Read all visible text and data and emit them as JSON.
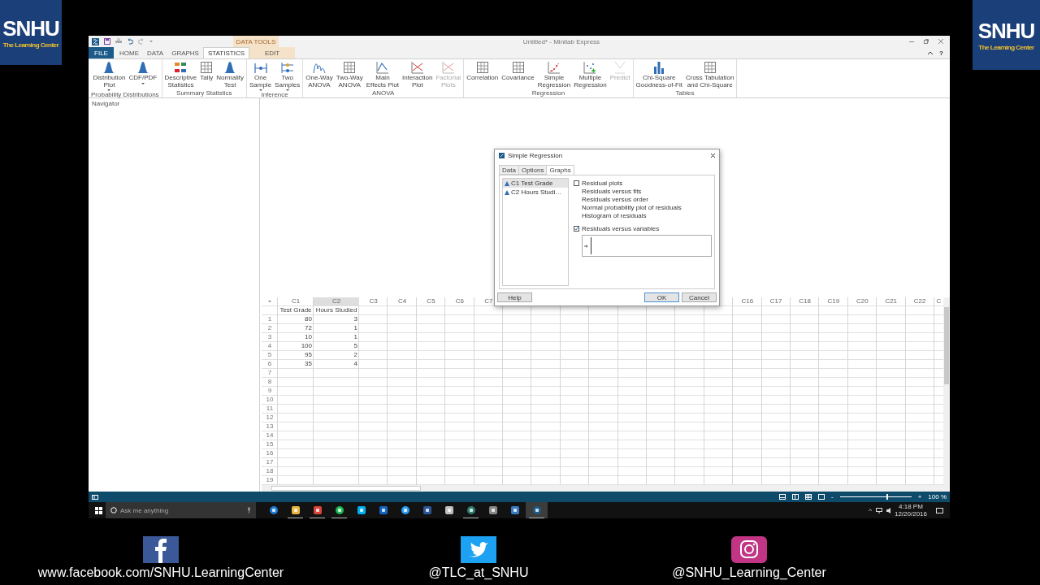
{
  "logos": [
    {
      "title": "SNHU",
      "subtitle": "The Learning Center"
    },
    {
      "title": "SNHU",
      "subtitle": "The Learning Center"
    }
  ],
  "window": {
    "title": "Untitled* - Minitab Express",
    "help_label": "?"
  },
  "contextual_group": "DATA TOOLS",
  "tabs": [
    {
      "label": "FILE",
      "kind": "file",
      "selected": false
    },
    {
      "label": "HOME",
      "kind": "normal",
      "selected": false
    },
    {
      "label": "DATA",
      "kind": "normal",
      "selected": false
    },
    {
      "label": "GRAPHS",
      "kind": "normal",
      "selected": false
    },
    {
      "label": "STATISTICS",
      "kind": "normal",
      "selected": true
    },
    {
      "label": "EDIT",
      "kind": "contextual",
      "selected": false
    }
  ],
  "ribbon": [
    {
      "label": "Probability Distributions",
      "buttons": [
        {
          "label": "Distribution\nPlot",
          "dropdown": true,
          "disabled": false
        },
        {
          "label": "CDF/PDF",
          "dropdown": true,
          "disabled": false
        }
      ]
    },
    {
      "label": "Summary Statistics",
      "buttons": [
        {
          "label": "Descriptive\nStatistics",
          "dropdown": false,
          "disabled": false
        },
        {
          "label": "Tally",
          "dropdown": false,
          "disabled": false
        },
        {
          "label": "Normality\nTest",
          "dropdown": false,
          "disabled": false
        }
      ]
    },
    {
      "label": "Inference",
      "buttons": [
        {
          "label": "One\nSample",
          "dropdown": true,
          "disabled": false
        },
        {
          "label": "Two\nSamples",
          "dropdown": true,
          "disabled": false
        }
      ]
    },
    {
      "label": "ANOVA",
      "buttons": [
        {
          "label": "One-Way\nANOVA",
          "dropdown": false,
          "disabled": false
        },
        {
          "label": "Two-Way\nANOVA",
          "dropdown": false,
          "disabled": false
        },
        {
          "label": "Main\nEffects Plot",
          "dropdown": false,
          "disabled": false
        },
        {
          "label": "Interaction\nPlot",
          "dropdown": false,
          "disabled": false
        },
        {
          "label": "Factorial\nPlots",
          "dropdown": false,
          "disabled": true
        }
      ]
    },
    {
      "label": "Regression",
      "buttons": [
        {
          "label": "Correlation",
          "dropdown": false,
          "disabled": false
        },
        {
          "label": "Covariance",
          "dropdown": false,
          "disabled": false
        },
        {
          "label": "Simple\nRegression",
          "dropdown": false,
          "disabled": false
        },
        {
          "label": "Multiple\nRegression",
          "dropdown": false,
          "disabled": false
        },
        {
          "label": "Predict",
          "dropdown": false,
          "disabled": true
        }
      ]
    },
    {
      "label": "Tables",
      "buttons": [
        {
          "label": "Chi-Square\nGoodness-of-Fit",
          "dropdown": false,
          "disabled": false
        },
        {
          "label": "Cross Tabulation\nand Chi-Square",
          "dropdown": false,
          "disabled": false
        }
      ]
    }
  ],
  "navigator": {
    "title": "Navigator"
  },
  "worksheet": {
    "columns": [
      {
        "header": "C1",
        "name": "Test Grade",
        "selected": false
      },
      {
        "header": "C2",
        "name": "Hours Studied",
        "selected": true
      },
      {
        "header": "C3",
        "selected": false
      },
      {
        "header": "C4",
        "selected": false
      },
      {
        "header": "C5",
        "selected": false
      },
      {
        "header": "C6",
        "selected": false
      },
      {
        "header": "C7",
        "selected": false
      }
    ],
    "columns_right": [
      {
        "header": "C16",
        "selected": false
      },
      {
        "header": "C17",
        "selected": false
      },
      {
        "header": "C18",
        "selected": false
      },
      {
        "header": "C19",
        "selected": false
      },
      {
        "header": "C20",
        "selected": false
      },
      {
        "header": "C21",
        "selected": false
      },
      {
        "header": "C22",
        "selected": false
      },
      {
        "header": "C",
        "selected": false
      }
    ],
    "rows": [
      {
        "number": "1",
        "cells": [
          "80",
          "3"
        ]
      },
      {
        "number": "2",
        "cells": [
          "72",
          "1"
        ]
      },
      {
        "number": "3",
        "cells": [
          "10",
          "1"
        ]
      },
      {
        "number": "4",
        "cells": [
          "100",
          "5"
        ]
      },
      {
        "number": "5",
        "cells": [
          "95",
          "2"
        ]
      },
      {
        "number": "6",
        "cells": [
          "35",
          "4"
        ]
      },
      {
        "number": "7"
      },
      {
        "number": "8"
      },
      {
        "number": "9"
      },
      {
        "number": "10"
      },
      {
        "number": "11"
      },
      {
        "number": "12"
      },
      {
        "number": "13"
      },
      {
        "number": "14"
      },
      {
        "number": "15"
      },
      {
        "number": "16"
      },
      {
        "number": "17"
      },
      {
        "number": "18"
      },
      {
        "number": "19"
      }
    ]
  },
  "dialog": {
    "title": "Simple Regression",
    "tabs": [
      {
        "label": "Data",
        "selected": false
      },
      {
        "label": "Options",
        "selected": false
      },
      {
        "label": "Graphs",
        "selected": true
      }
    ],
    "variables": [
      {
        "label": "C1 Test Grade",
        "selected": true
      },
      {
        "label": "C2 Hours Studi…",
        "selected": false
      }
    ],
    "options": [
      {
        "kind": "checkbox",
        "label": "Residual plots",
        "checked": false
      },
      {
        "kind": "sub",
        "label": "Residuals versus fits"
      },
      {
        "kind": "sub",
        "label": "Residuals versus order"
      },
      {
        "kind": "sub",
        "label": "Normal probability plot of residuals"
      },
      {
        "kind": "sub",
        "label": "Histogram of residuals"
      },
      {
        "kind": "checkbox",
        "label": "Residuals versus variables",
        "checked": true
      }
    ],
    "buttons": [
      {
        "label": "Help",
        "kind": "help"
      },
      {
        "label": "OK",
        "kind": "default"
      },
      {
        "label": "Cancel",
        "kind": "normal"
      }
    ]
  },
  "status_bar": {
    "zoom_out": "-",
    "zoom_in": "+",
    "zoom": "100 %",
    "level": 0.66
  },
  "taskbar": {
    "search_placeholder": "Ask me anything",
    "apps": [
      {
        "running": false,
        "active": false
      },
      {
        "running": true,
        "active": false
      },
      {
        "running": true,
        "active": false
      },
      {
        "running": true,
        "active": false
      },
      {
        "running": false,
        "active": false
      },
      {
        "running": false,
        "active": false
      },
      {
        "running": false,
        "active": false
      },
      {
        "running": false,
        "active": false
      },
      {
        "running": false,
        "active": false
      },
      {
        "running": true,
        "active": false
      },
      {
        "running": false,
        "active": false
      },
      {
        "running": false,
        "active": false
      },
      {
        "running": true,
        "active": true
      }
    ],
    "tray_chevron": "^",
    "time": "4:18 PM",
    "date": "12/20/2016"
  },
  "social": [
    {
      "kind": "facebook",
      "text": "www.facebook.com/SNHU.LearningCenter"
    },
    {
      "kind": "twitter",
      "text": "@TLC_at_SNHU"
    },
    {
      "kind": "instagram",
      "text": "@SNHU_Learning_Center"
    }
  ]
}
